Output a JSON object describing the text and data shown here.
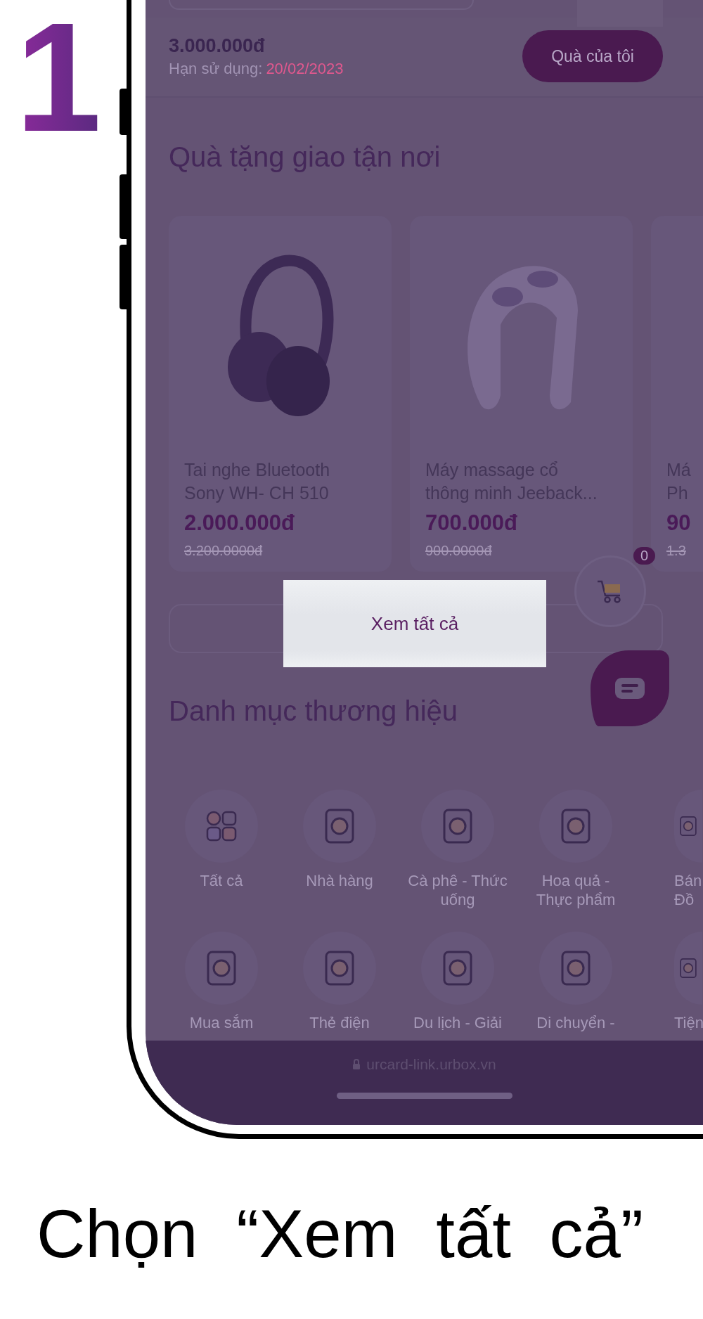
{
  "step_number": "1",
  "balance": {
    "amount": "3.000.000đ",
    "expiry_label": "Hạn sử dụng:",
    "expiry_date": "20/02/2023",
    "button": "Quà của tôi"
  },
  "delivery_section": {
    "title": "Quà tặng giao tận nơi",
    "products": [
      {
        "name_lines": [
          "Tai nghe Bluetooth",
          "Sony WH- CH 510"
        ],
        "price": "2.000.000đ",
        "old_price": "3.200.0000đ"
      },
      {
        "name_lines": [
          "Máy massage cổ",
          "thông minh Jeeback..."
        ],
        "price": "700.000đ",
        "old_price": "900.0000đ"
      },
      {
        "name_lines": [
          "Má",
          "Ph"
        ],
        "price": "90",
        "old_price": "1.3"
      }
    ]
  },
  "view_all_button": "Xem tất cả",
  "cart": {
    "count": "0"
  },
  "brand_section": {
    "title": "Danh mục thương hiệu",
    "rows": [
      [
        "Tất cả",
        "Nhà hàng",
        "Cà phê - Thức uống",
        "Hoa quả - Thực phẩm",
        "Bán Đồ"
      ],
      [
        "Mua sắm",
        "Thẻ điện",
        "Du lịch - Giải",
        "Di chuyển -",
        "Tiện"
      ]
    ]
  },
  "browser_bar": {
    "url": "urcard-link.urbox.vn"
  },
  "caption": "Chọn “Xem tất cả”"
}
